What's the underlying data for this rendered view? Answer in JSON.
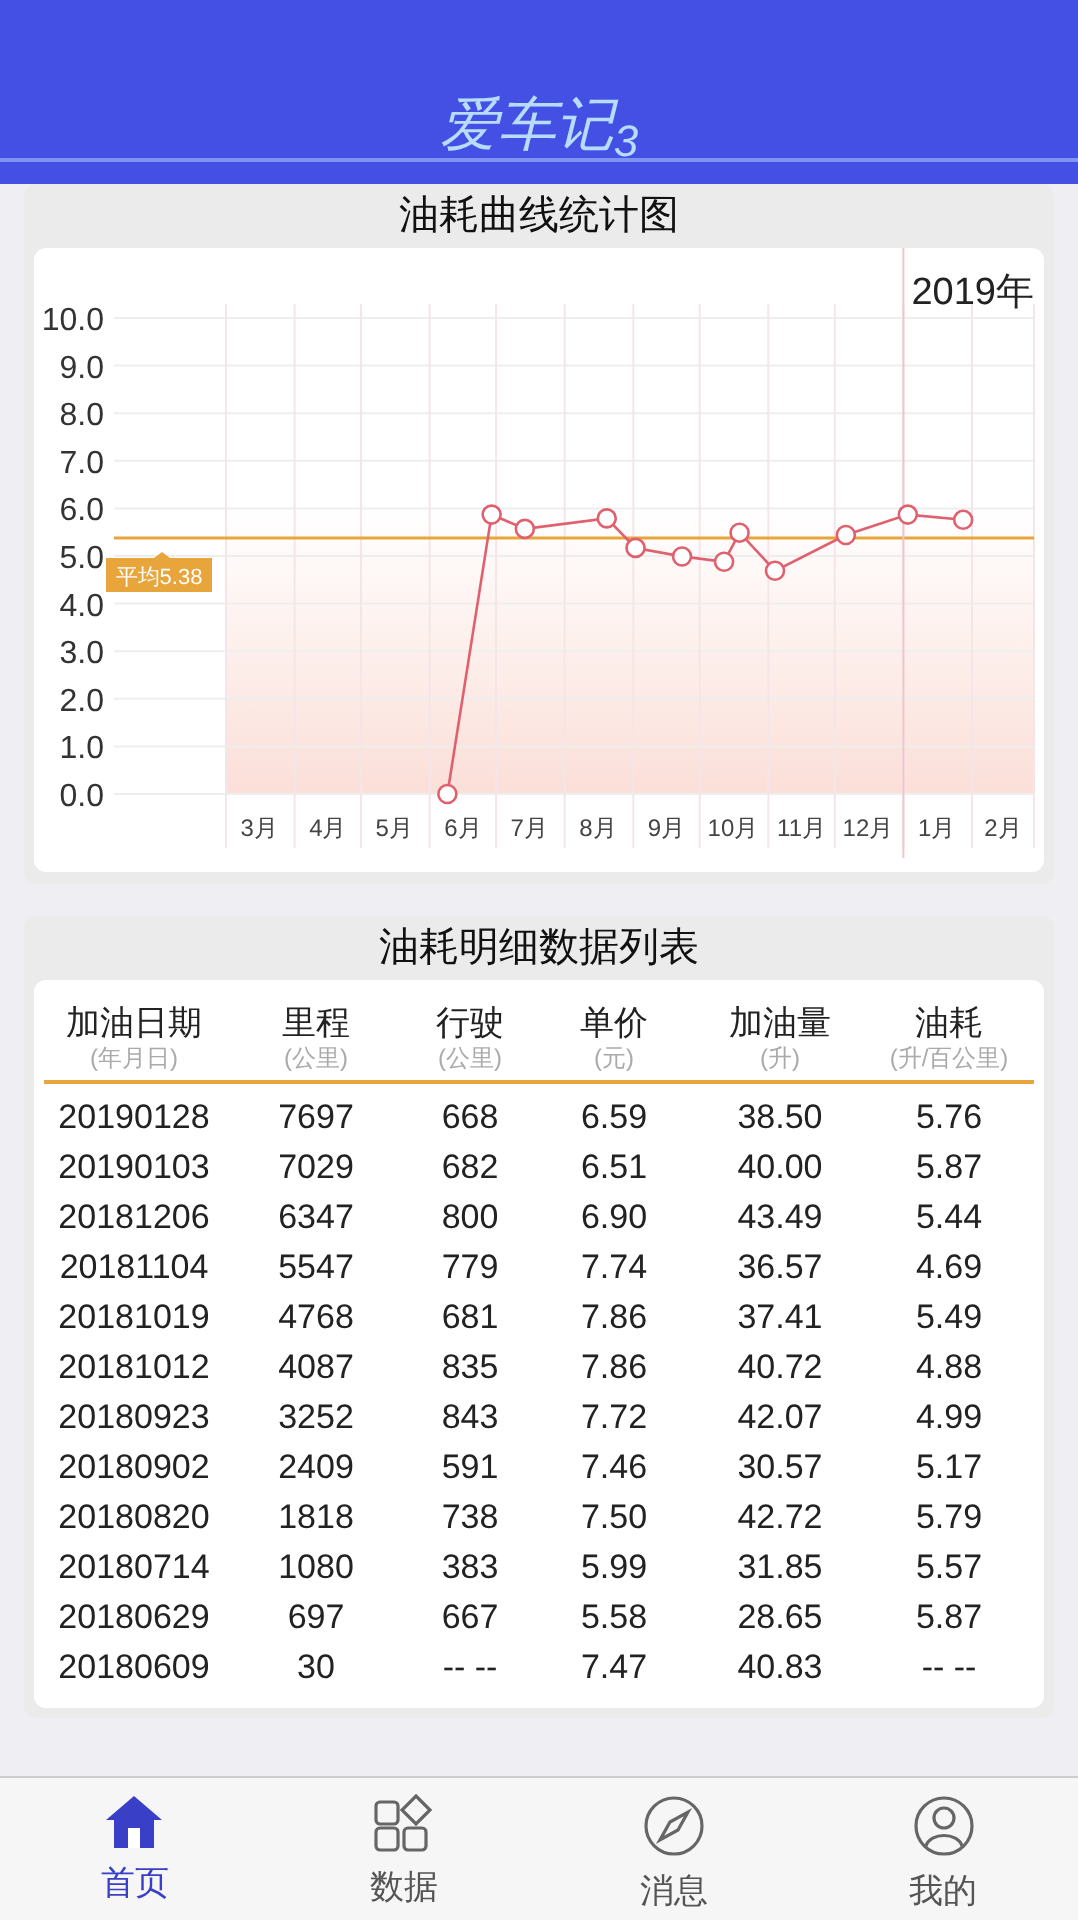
{
  "header": {
    "logo": "爱车记$_{3}$"
  },
  "chart_card": {
    "title": "油耗曲线统计图",
    "chart_data": {
      "type": "line",
      "x": [
        "2018-06-09",
        "2018-06-29",
        "2018-07-14",
        "2018-08-20",
        "2018-09-02",
        "2018-09-23",
        "2018-10-12",
        "2018-10-19",
        "2018-11-04",
        "2018-12-06",
        "2019-01-03",
        "2019-01-28"
      ],
      "series": [
        {
          "color": "#e0606e",
          "marker": "o",
          "values": [
            0,
            5.87,
            5.57,
            5.79,
            5.17,
            4.99,
            4.88,
            5.49,
            4.69,
            5.44,
            5.87,
            5.76
          ]
        }
      ],
      "xlim": [
        "2018-03-01",
        "2019-03-01"
      ],
      "xticks": [
        {
          "value": "2018-03-16",
          "label": "3月"
        },
        {
          "value": "2018-04-16",
          "label": "4月"
        },
        {
          "value": "2018-05-16",
          "label": "5月"
        },
        {
          "value": "2018-06-16",
          "label": "6月"
        },
        {
          "value": "2018-07-16",
          "label": "7月"
        },
        {
          "value": "2018-08-16",
          "label": "8月"
        },
        {
          "value": "2018-09-16",
          "label": "9月"
        },
        {
          "value": "2018-10-16",
          "label": "10月"
        },
        {
          "value": "2018-11-16",
          "label": "11月"
        },
        {
          "value": "2018-12-16",
          "label": "12月"
        },
        {
          "value": "2019-01-16",
          "label": "1月"
        },
        {
          "value": "2019-02-15",
          "label": "2月"
        }
      ],
      "ylim": [
        0,
        10
      ],
      "grid": true,
      "yticks": [
        {
          "value": 0,
          "label": "0.0"
        },
        {
          "value": 1,
          "label": "1.0"
        },
        {
          "value": 2,
          "label": "2.0"
        },
        {
          "value": 3,
          "label": "3.0"
        },
        {
          "value": 4,
          "label": "4.0"
        },
        {
          "value": 5,
          "label": "5.0"
        },
        {
          "value": 6,
          "label": "6.0"
        },
        {
          "value": 7,
          "label": "7.0"
        },
        {
          "value": 8,
          "label": "8.0"
        },
        {
          "value": 9,
          "label": "9.0"
        },
        {
          "value": 10,
          "label": "10.0"
        }
      ],
      "ref_lines": [
        {
          "axis": "y",
          "value": 5.38,
          "label": "平均5.38",
          "color": "#e8a53b"
        },
        {
          "axis": "x",
          "value": "2019-01-01",
          "label": "2019年",
          "color": "#f0c6cc"
        }
      ],
      "bands": [
        {
          "axis": "y",
          "from": 0,
          "to": 6,
          "color": "#fbdfd8"
        }
      ]
    }
  },
  "table_card": {
    "title": "油耗明细数据列表",
    "columns": [
      {
        "label": "加油日期",
        "unit": "(年月日)"
      },
      {
        "label": "里程",
        "unit": "(公里)"
      },
      {
        "label": "行驶",
        "unit": "(公里)"
      },
      {
        "label": "单价",
        "unit": "(元)"
      },
      {
        "label": "加油量",
        "unit": "(升)"
      },
      {
        "label": "油耗",
        "unit": "(升/百公里)"
      }
    ],
    "rows": [
      [
        "20190128",
        "7697",
        "668",
        "6.59",
        "38.50",
        "5.76"
      ],
      [
        "20190103",
        "7029",
        "682",
        "6.51",
        "40.00",
        "5.87"
      ],
      [
        "20181206",
        "6347",
        "800",
        "6.90",
        "43.49",
        "5.44"
      ],
      [
        "20181104",
        "5547",
        "779",
        "7.74",
        "36.57",
        "4.69"
      ],
      [
        "20181019",
        "4768",
        "681",
        "7.86",
        "37.41",
        "5.49"
      ],
      [
        "20181012",
        "4087",
        "835",
        "7.86",
        "40.72",
        "4.88"
      ],
      [
        "20180923",
        "3252",
        "843",
        "7.72",
        "42.07",
        "4.99"
      ],
      [
        "20180902",
        "2409",
        "591",
        "7.46",
        "30.57",
        "5.17"
      ],
      [
        "20180820",
        "1818",
        "738",
        "7.50",
        "42.72",
        "5.79"
      ],
      [
        "20180714",
        "1080",
        "383",
        "5.99",
        "31.85",
        "5.57"
      ],
      [
        "20180629",
        "697",
        "667",
        "5.58",
        "28.65",
        "5.87"
      ],
      [
        "20180609",
        "30",
        "-- --",
        "7.47",
        "40.83",
        "-- --"
      ]
    ]
  },
  "tab_bar": [
    {
      "kind": "home",
      "label": "首页",
      "selected": true
    },
    {
      "kind": "data",
      "label": "数据",
      "selected": false
    },
    {
      "kind": "compass",
      "label": "消息",
      "selected": false
    },
    {
      "kind": "user",
      "label": "我的",
      "selected": false
    }
  ]
}
